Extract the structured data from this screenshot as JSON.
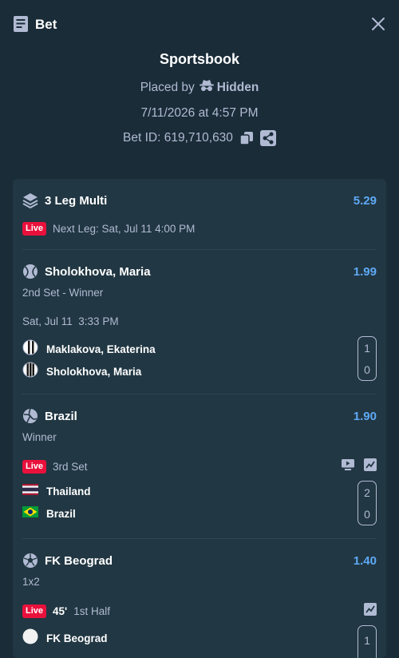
{
  "header": {
    "title": "Bet",
    "icon": "receipt-icon",
    "close_icon": "close-icon"
  },
  "bet": {
    "source": "Sportsbook",
    "placed_by_label": "Placed by",
    "placed_by_user": "Hidden",
    "datetime": "7/11/2026 at 4:57 PM",
    "bet_id_label": "Bet ID: 619,710,630"
  },
  "multi": {
    "title": "3 Leg Multi",
    "odds": "5.29",
    "live_badge": "Live",
    "next_leg": "Next Leg: Sat, Jul 11 4:00 PM"
  },
  "legs": [
    {
      "selection": "Sholokhova, Maria",
      "odds": "1.99",
      "market": "2nd Set - Winner",
      "sport_icon": "tennis-icon",
      "start_time": "Sat, Jul 11  3:33 PM",
      "teams": [
        {
          "name": "Maklakova, Ekaterina",
          "score": "1"
        },
        {
          "name": "Sholokhova, Maria",
          "score": "0"
        }
      ]
    },
    {
      "selection": "Brazil",
      "odds": "1.90",
      "market": "Winner",
      "sport_icon": "volleyball-icon",
      "live_badge": "Live",
      "status": "3rd Set",
      "teams": [
        {
          "name": "Thailand",
          "score": "2"
        },
        {
          "name": "Brazil",
          "score": "0"
        }
      ]
    },
    {
      "selection": "FK Beograd",
      "odds": "1.40",
      "market": "1x2",
      "sport_icon": "soccer-icon",
      "live_badge": "Live",
      "clock": "45'",
      "status": "1st Half",
      "teams": [
        {
          "name": "FK Beograd",
          "score": "1"
        }
      ]
    }
  ],
  "colors": {
    "background": "#1a2c38",
    "card": "#213743",
    "odds": "#5fa9f5",
    "live": "#e9113c",
    "muted": "#b1bad3"
  }
}
